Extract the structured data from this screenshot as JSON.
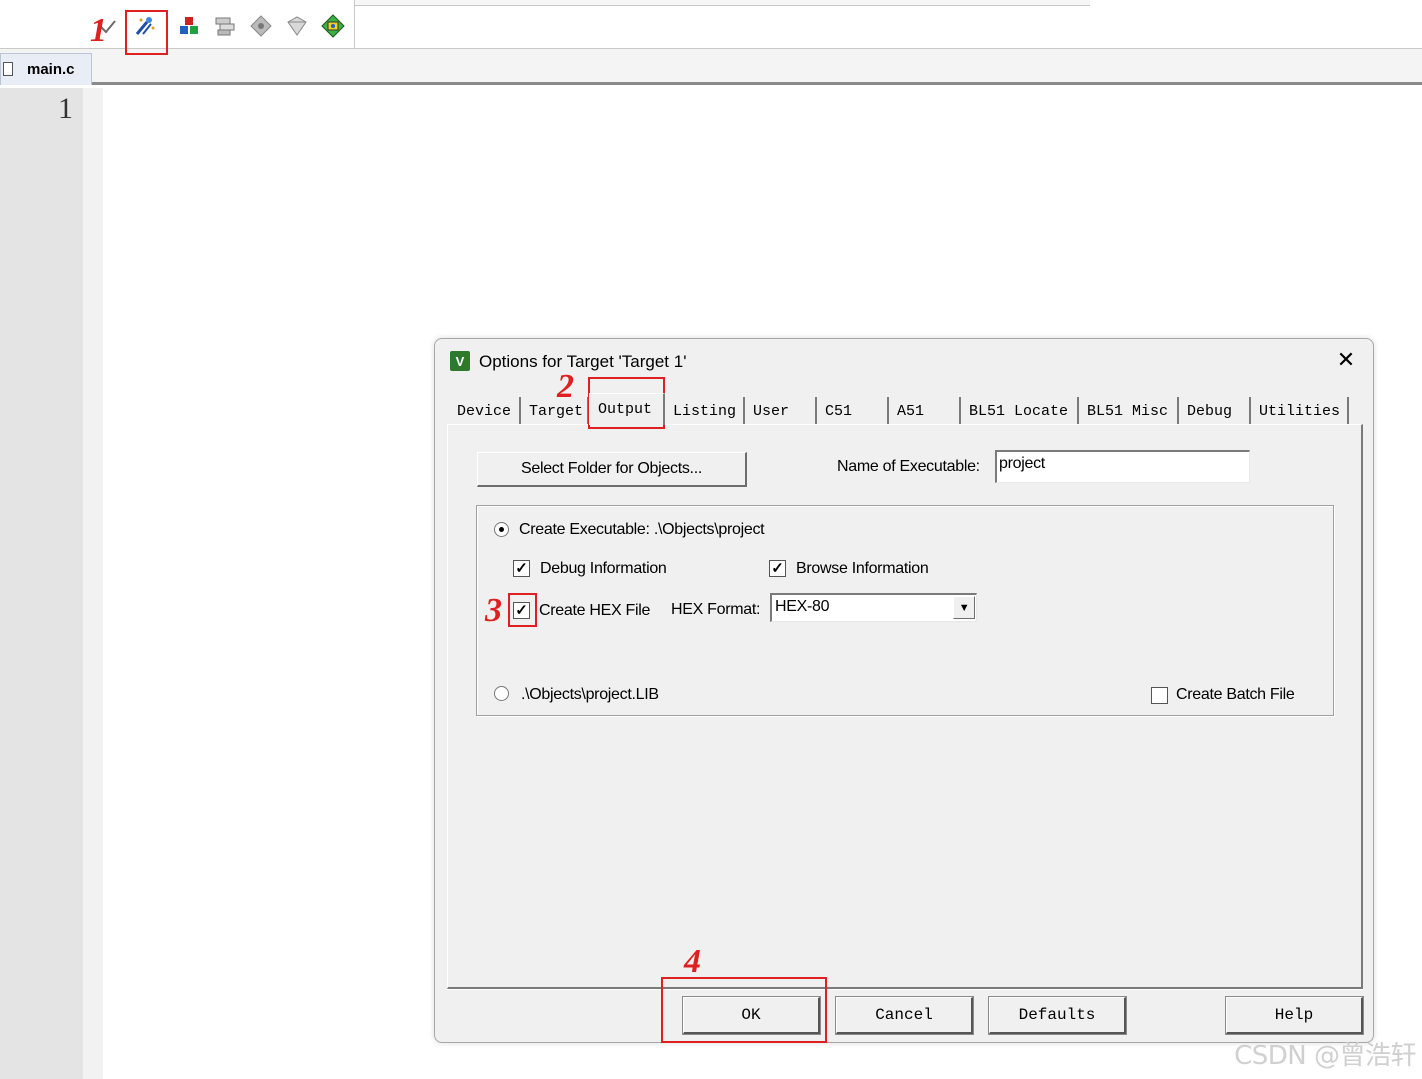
{
  "editor": {
    "file_tab": "main.c",
    "line_numbers": [
      "1"
    ]
  },
  "annotations": {
    "step1": "1",
    "step2": "2",
    "step3": "3",
    "step4": "4"
  },
  "toolbar": {
    "icons": [
      "translate-icon",
      "options-for-target-icon",
      "manage-components-icon",
      "file-extensions-icon",
      "select-packs-icon",
      "pack-installer-icon",
      "rte-icon"
    ]
  },
  "dialog": {
    "title": "Options for Target 'Target 1'",
    "close_symbol": "✕",
    "app_icon_letter": "V",
    "tabs": [
      "Device",
      "Target",
      "Output",
      "Listing",
      "User",
      "C51",
      "A51",
      "BL51 Locate",
      "BL51 Misc",
      "Debug",
      "Utilities"
    ],
    "active_tab": "Output",
    "select_folder_button": "Select Folder for Objects...",
    "name_of_executable_label": "Name of Executable:",
    "name_of_executable_value": "project",
    "create_executable": {
      "label": "Create Executable:  .\\Objects\\project",
      "selected": true
    },
    "debug_information": {
      "label": "Debug Information",
      "checked": true
    },
    "browse_information": {
      "label": "Browse Information",
      "checked": true
    },
    "create_hex_file": {
      "label": "Create HEX File",
      "checked": true
    },
    "hex_format_label": "HEX Format:",
    "hex_format_value": "HEX-80",
    "create_library": {
      "label": ".\\Objects\\project.LIB",
      "selected": false
    },
    "create_batch_file": {
      "label": "Create Batch File",
      "checked": false
    },
    "buttons": {
      "ok": "OK",
      "cancel": "Cancel",
      "defaults": "Defaults",
      "help": "Help"
    }
  },
  "watermark": "CSDN @曾浩轩",
  "colors": {
    "annotation_red": "#e02020",
    "dialog_bg": "#f0f0f0",
    "gutter": "#e4e4e4"
  }
}
